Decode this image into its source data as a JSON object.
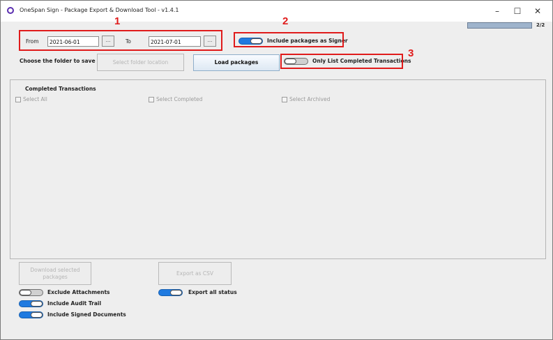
{
  "window": {
    "title": "OneSpan Sign - Package Export & Download Tool - v1.4.1",
    "minimize": "–",
    "maximize": "☐",
    "close": "✕"
  },
  "progress": {
    "value": 1.0,
    "text": "2/2"
  },
  "dates": {
    "from_label": "From",
    "from_value": "2021-06-01",
    "from_picker": "...",
    "to_label": "To",
    "to_value": "2021-07-01",
    "to_picker": "..."
  },
  "toggles": {
    "include_signer": {
      "label": "Include packages as Signer",
      "on": true
    },
    "only_completed": {
      "label": "Only List Completed Transactions",
      "on": false
    },
    "exclude_attachments": {
      "label": "Exclude Attachments",
      "on": false
    },
    "include_audit": {
      "label": "Include Audit Trail",
      "on": true
    },
    "include_signed": {
      "label": "Include Signed Documents",
      "on": true
    },
    "export_all": {
      "label": "Export all status",
      "on": true
    }
  },
  "folder": {
    "label": "Choose the folder to save",
    "select_button": "Select folder location",
    "load_button": "Load packages"
  },
  "transactions": {
    "title": "Completed Transactions",
    "select_all": "Select All",
    "select_completed": "Select Completed",
    "select_archived": "Select Archived"
  },
  "actions": {
    "download": "Download selected packages",
    "export_csv": "Export as CSV"
  },
  "annotations": {
    "n1": "1",
    "n2": "2",
    "n3": "3",
    "color": "#e01b1b"
  }
}
